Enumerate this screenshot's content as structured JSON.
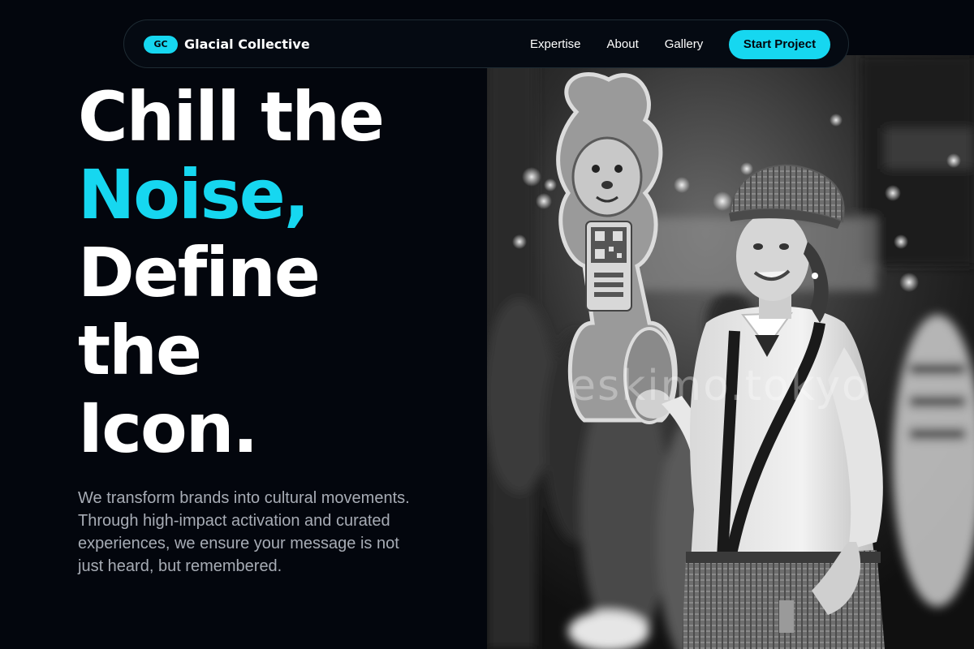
{
  "nav": {
    "logo_badge": "GC",
    "brand_name": "Glacial Collective",
    "links": [
      {
        "label": "Expertise"
      },
      {
        "label": "About"
      },
      {
        "label": "Gallery"
      }
    ],
    "cta_label": "Start Project"
  },
  "hero": {
    "headline_lines": [
      "Chill the",
      "Noise,",
      "Define",
      "the",
      "Icon."
    ],
    "tagline": "We transform brands into cultural movements. Through high-impact activation and curated experiences, we ensure your message is not just heard, but remembered."
  },
  "photo": {
    "watermark": "eskimo.tokyo"
  },
  "colors": {
    "accent": "#16d7f0",
    "background": "#03060d",
    "body_text": "#a7acb5"
  }
}
